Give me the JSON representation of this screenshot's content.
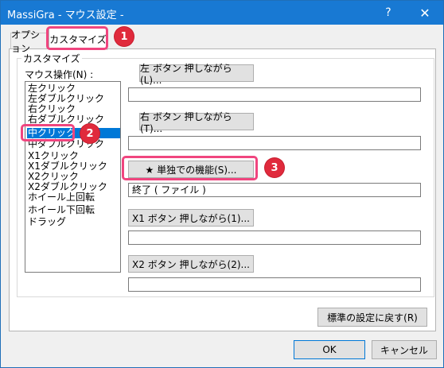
{
  "window": {
    "title": "MassiGra - マウス設定 -",
    "help": "?",
    "close": "✕"
  },
  "tabs": [
    {
      "label": "オプション"
    },
    {
      "label": "カスタマイズ"
    }
  ],
  "group": {
    "label": "カスタマイズ"
  },
  "mouse_ops": {
    "label": "マウス操作(N) :",
    "items": [
      "左クリック",
      "左ダブルクリック",
      "右クリック",
      "右ダブルクリック",
      "中クリック",
      "中ダブルクリック",
      "X1クリック",
      "X1ダブルクリック",
      "X2クリック",
      "X2ダブルクリック",
      "ホイール上回転",
      "ホイール下回転",
      "ドラッグ"
    ],
    "selected": "中クリック"
  },
  "actions": {
    "left_button": "左 ボタン 押しながら(L)...",
    "left_value": "",
    "right_button": "右 ボタン 押しながら(T)...",
    "right_value": "",
    "single_button": "★ 単独での機能(S)...",
    "single_value": "終了 ( ファイル )",
    "x1_button": "X1 ボタン 押しながら(1)...",
    "x1_value": "",
    "x2_button": "X2 ボタン 押しながら(2)...",
    "x2_value": ""
  },
  "reset_button": "標準の設定に戻す(R)",
  "ok_button": "OK",
  "cancel_button": "キャンセル",
  "annotations": [
    "1",
    "2",
    "3"
  ],
  "colors": {
    "titlebar": "#1879d3",
    "selection": "#0078d7",
    "highlight": "#f0457f",
    "badge": "#e02a3c"
  }
}
